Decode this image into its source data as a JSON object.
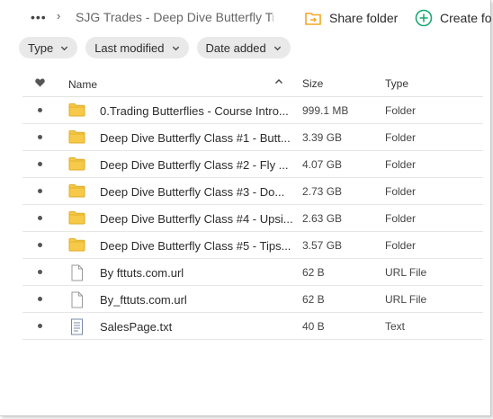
{
  "breadcrumb": {
    "more": "•••",
    "separator": "›",
    "current": "SJG Trades - Deep Dive Butterfly Tra..."
  },
  "toolbar": {
    "share_folder": "Share folder",
    "create": "Create fo"
  },
  "filters": [
    {
      "label": "Type"
    },
    {
      "label": "Last modified"
    },
    {
      "label": "Date added"
    }
  ],
  "table": {
    "headers": {
      "name": "Name",
      "size": "Size",
      "type": "Type"
    },
    "rows": [
      {
        "name": "0.Trading Butterflies - Course Intro...",
        "size": "999.1 MB",
        "type": "Folder",
        "icon": "folder-icon"
      },
      {
        "name": "Deep Dive Butterfly Class #1 - Butt...",
        "size": "3.39 GB",
        "type": "Folder",
        "icon": "folder-icon"
      },
      {
        "name": "Deep Dive Butterfly Class #2 - Fly ...",
        "size": "4.07 GB",
        "type": "Folder",
        "icon": "folder-icon"
      },
      {
        "name": "Deep Dive Butterfly Class #3 - Do...",
        "size": "2.73 GB",
        "type": "Folder",
        "icon": "folder-icon"
      },
      {
        "name": "Deep Dive Butterfly Class #4 - Upsi...",
        "size": "2.63 GB",
        "type": "Folder",
        "icon": "folder-icon"
      },
      {
        "name": "Deep Dive Butterfly Class #5 - Tips...",
        "size": "3.57 GB",
        "type": "Folder",
        "icon": "folder-icon"
      },
      {
        "name": "By fttuts.com.url",
        "size": "62 B",
        "type": "URL File",
        "icon": "file-icon"
      },
      {
        "name": "By_fttuts.com.url",
        "size": "62 B",
        "type": "URL File",
        "icon": "file-icon"
      },
      {
        "name": "SalesPage.txt",
        "size": "40 B",
        "type": "Text",
        "icon": "text-file-icon"
      }
    ]
  },
  "colors": {
    "folder": "#f7c948",
    "share_icon": "#f5a623",
    "create_icon": "#1aa874",
    "chip_bg": "#e9e9e9"
  }
}
